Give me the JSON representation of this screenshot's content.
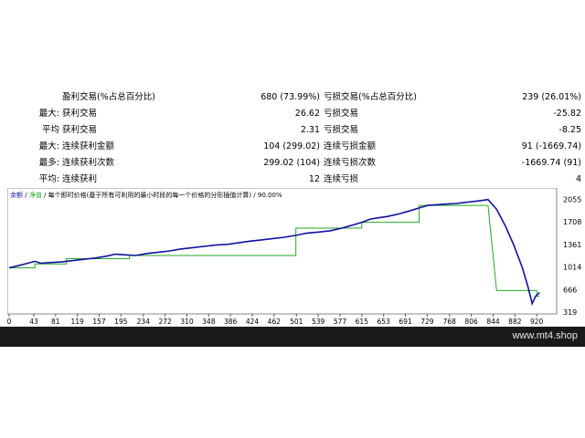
{
  "stats_rows": [
    {
      "prefix": "",
      "label1": "盈利交易(%占总百分比)",
      "value1": "680 (73.99%)",
      "label2": "亏损交易(%占总百分比)",
      "value2": "239 (26.01%)"
    },
    {
      "prefix": "最大:",
      "label1": "获利交易",
      "value1": "26.62",
      "label2": "亏损交易",
      "value2": "-25.82"
    },
    {
      "prefix": "平均",
      "label1": "获利交易",
      "value1": "2.31",
      "label2": "亏损交易",
      "value2": "-8.25"
    },
    {
      "prefix": "最大:",
      "label1": "连续获利金额",
      "value1": "104 (299.02)",
      "label2": "连续亏损金额",
      "value2": "91 (-1669.74)"
    },
    {
      "prefix": "最多:",
      "label1": "连续获利次数",
      "value1": "299.02 (104)",
      "label2": "连续亏损次数",
      "value2": "-1669.74 (91)"
    },
    {
      "prefix": "平均:",
      "label1": "连续获利",
      "value1": "12",
      "label2": "连续亏损",
      "value2": "4"
    }
  ],
  "chart_data": {
    "type": "line",
    "legend_text": {
      "balance": "余额",
      "separator1": " / ",
      "equity": "净值",
      "rest": " / 每个即时价格(基于所有可利用的最小时段的每一个价格的分形插值计算) / 90.00%"
    },
    "x_ticks": [
      0,
      43,
      81,
      119,
      157,
      195,
      234,
      272,
      310,
      348,
      386,
      424,
      462,
      501,
      539,
      577,
      615,
      653,
      691,
      729,
      768,
      806,
      844,
      882,
      920
    ],
    "y_ticks": [
      319,
      666,
      1014,
      1361,
      1708,
      2055
    ],
    "xlim": [
      0,
      950
    ],
    "ylim": [
      319,
      2200
    ],
    "colors": {
      "balance": "#1010a0",
      "equity": "#22aa22",
      "balance_legend": "#1010a0",
      "equity_legend": "#22aa22"
    },
    "series": [
      {
        "key": "balance",
        "points": [
          [
            0,
            1000
          ],
          [
            15,
            1030
          ],
          [
            30,
            1065
          ],
          [
            45,
            1100
          ],
          [
            55,
            1070
          ],
          [
            70,
            1080
          ],
          [
            90,
            1090
          ],
          [
            110,
            1110
          ],
          [
            130,
            1130
          ],
          [
            150,
            1150
          ],
          [
            170,
            1180
          ],
          [
            185,
            1210
          ],
          [
            200,
            1200
          ],
          [
            220,
            1190
          ],
          [
            240,
            1220
          ],
          [
            260,
            1240
          ],
          [
            280,
            1260
          ],
          [
            300,
            1290
          ],
          [
            320,
            1310
          ],
          [
            340,
            1330
          ],
          [
            360,
            1350
          ],
          [
            380,
            1360
          ],
          [
            400,
            1385
          ],
          [
            420,
            1410
          ],
          [
            440,
            1430
          ],
          [
            460,
            1450
          ],
          [
            480,
            1470
          ],
          [
            500,
            1500
          ],
          [
            520,
            1535
          ],
          [
            540,
            1550
          ],
          [
            560,
            1570
          ],
          [
            580,
            1610
          ],
          [
            600,
            1660
          ],
          [
            615,
            1700
          ],
          [
            630,
            1750
          ],
          [
            645,
            1770
          ],
          [
            660,
            1790
          ],
          [
            680,
            1830
          ],
          [
            700,
            1880
          ],
          [
            715,
            1920
          ],
          [
            730,
            1960
          ],
          [
            745,
            1970
          ],
          [
            760,
            1980
          ],
          [
            780,
            1990
          ],
          [
            800,
            2010
          ],
          [
            820,
            2030
          ],
          [
            835,
            2050
          ],
          [
            850,
            1900
          ],
          [
            865,
            1650
          ],
          [
            880,
            1350
          ],
          [
            895,
            1000
          ],
          [
            905,
            700
          ],
          [
            912,
            450
          ],
          [
            918,
            560
          ],
          [
            925,
            620
          ]
        ]
      },
      {
        "key": "equity",
        "points": [
          [
            0,
            1000
          ],
          [
            15,
            1000
          ],
          [
            30,
            1000
          ],
          [
            45,
            1000
          ],
          [
            45,
            1060
          ],
          [
            100,
            1060
          ],
          [
            100,
            1140
          ],
          [
            210,
            1140
          ],
          [
            210,
            1190
          ],
          [
            500,
            1190
          ],
          [
            500,
            1610
          ],
          [
            615,
            1610
          ],
          [
            615,
            1700
          ],
          [
            715,
            1700
          ],
          [
            715,
            1960
          ],
          [
            835,
            1960
          ],
          [
            835,
            1960
          ],
          [
            850,
            650
          ],
          [
            920,
            650
          ],
          [
            920,
            560
          ],
          [
            925,
            560
          ]
        ]
      }
    ]
  }
}
